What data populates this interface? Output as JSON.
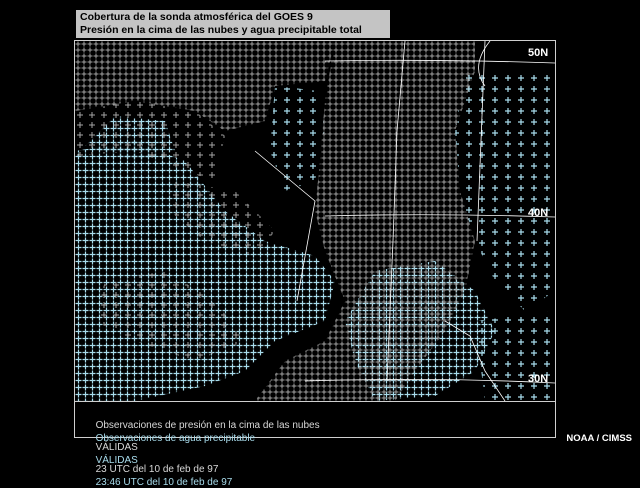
{
  "title": {
    "line1": "Cobertura de la sonda atmosférica del GOES 9",
    "line2": "Presión en la cima de las nubes y agua precipitable total"
  },
  "map": {
    "lat_labels": [
      "50N",
      "40N",
      "30N"
    ],
    "colors": {
      "cloud_top_pressure": "#9a9a9a",
      "precipitable_water": "#a8dcec",
      "background": "#000000",
      "grid": "#ffffff"
    }
  },
  "legend": {
    "cloud": {
      "label": "Observaciones de presión en la cima de las nubes",
      "valid_label": "VÁLIDAS",
      "time": "23 UTC del 10 de feb de 97"
    },
    "water": {
      "label": "Observaciones de agua precipitable",
      "valid_label": "VÁLIDAS",
      "time": "23:46 UTC del 10 de feb de 97"
    }
  },
  "credit": "NOAA / CIMSS"
}
